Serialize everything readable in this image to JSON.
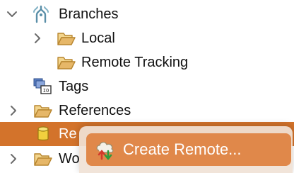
{
  "tree": {
    "branches": {
      "label": "Branches",
      "icon": "branches-icon",
      "expanded": true
    },
    "local": {
      "label": "Local",
      "icon": "folder-open-icon",
      "expanded": false
    },
    "remote_tracking": {
      "label": "Remote Tracking",
      "icon": "folder-open-icon"
    },
    "tags": {
      "label": "Tags",
      "icon": "tags-icon"
    },
    "references": {
      "label": "References",
      "icon": "folder-open-icon",
      "expanded": false
    },
    "remotes": {
      "label": "Re",
      "icon": "database-icon",
      "selected": true
    },
    "working_tree": {
      "label": "Wo",
      "icon": "folder-open-icon",
      "expanded": false
    }
  },
  "context_menu": {
    "create_remote": {
      "label": "Create Remote...",
      "icon": "create-remote-icon"
    }
  },
  "colors": {
    "selection": "#d3732b",
    "menu_highlight": "#e0884a",
    "menu_background": "#f0e2d6",
    "folder": "#e6b768"
  }
}
